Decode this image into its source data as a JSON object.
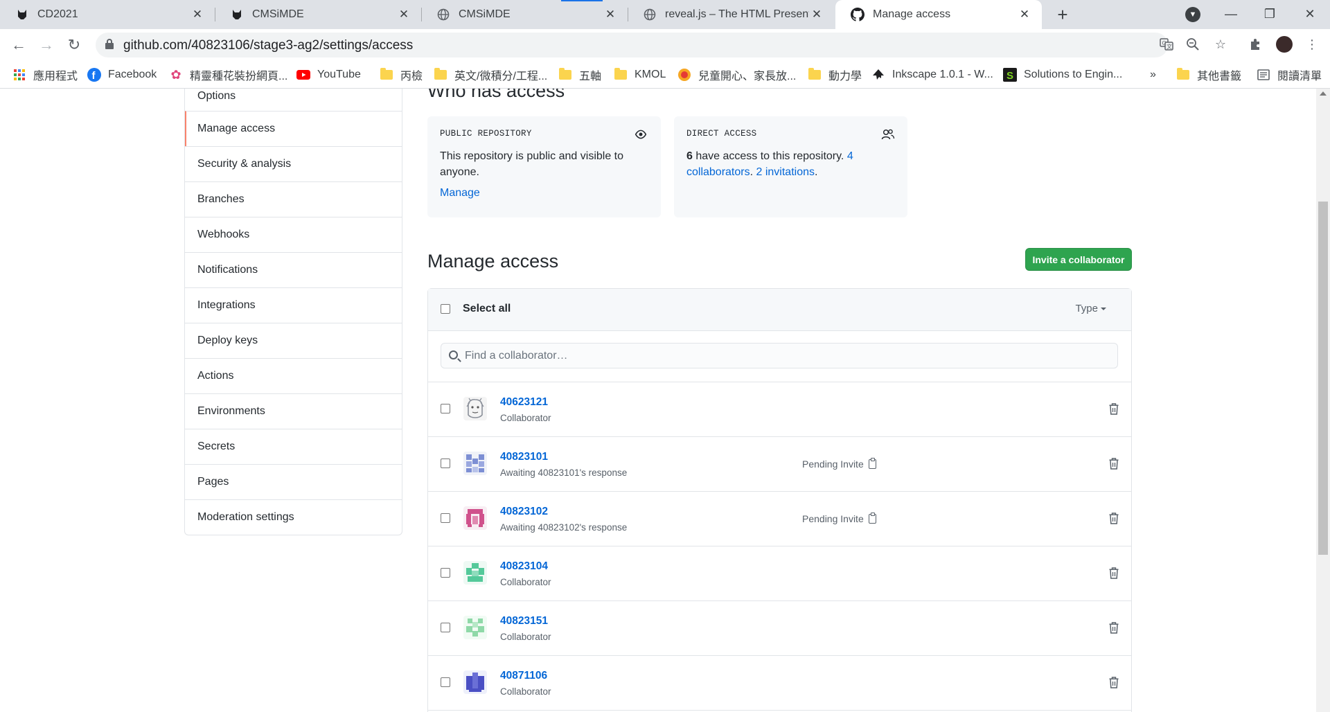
{
  "browser": {
    "tabs": [
      {
        "title": "CD2021",
        "icon": "cmsimde-cat-icon",
        "active": false
      },
      {
        "title": "CMSiMDE",
        "icon": "cmsimde-cat-icon",
        "active": false
      },
      {
        "title": "CMSiMDE",
        "icon": "globe-icon",
        "active": false
      },
      {
        "title": "reveal.js – The HTML Presentati",
        "icon": "globe-icon",
        "active": false
      },
      {
        "title": "Manage access",
        "icon": "github-icon",
        "active": true
      }
    ],
    "url": "github.com/40823106/stage3-ag2/settings/access",
    "bookmarks": [
      {
        "label": "應用程式",
        "icon": "apps-grid-icon"
      },
      {
        "label": "Facebook",
        "icon": "facebook-icon"
      },
      {
        "label": "精靈種花裝扮網頁...",
        "icon": "flower-icon"
      },
      {
        "label": "YouTube",
        "icon": "youtube-icon"
      },
      {
        "label": "丙檢",
        "icon": "folder-icon"
      },
      {
        "label": "英文/微積分/工程...",
        "icon": "folder-icon"
      },
      {
        "label": "五軸",
        "icon": "folder-icon"
      },
      {
        "label": "KMOL",
        "icon": "folder-icon"
      },
      {
        "label": "兒童開心、家長放...",
        "icon": "kids-site-icon"
      },
      {
        "label": "動力學",
        "icon": "folder-icon"
      },
      {
        "label": "Inkscape 1.0.1 - W...",
        "icon": "inkscape-icon"
      },
      {
        "label": "Solutions to Engin...",
        "icon": "s-logo-icon"
      }
    ],
    "bookmarks_overflow": "»",
    "other_bookmarks": "其他書籤",
    "reading_list": "閱讀清單"
  },
  "sidebar": {
    "items": [
      {
        "label": "Options",
        "selected": false
      },
      {
        "label": "Manage access",
        "selected": true
      },
      {
        "label": "Security & analysis",
        "selected": false
      },
      {
        "label": "Branches",
        "selected": false
      },
      {
        "label": "Webhooks",
        "selected": false
      },
      {
        "label": "Notifications",
        "selected": false
      },
      {
        "label": "Integrations",
        "selected": false
      },
      {
        "label": "Deploy keys",
        "selected": false
      },
      {
        "label": "Actions",
        "selected": false
      },
      {
        "label": "Environments",
        "selected": false
      },
      {
        "label": "Secrets",
        "selected": false
      },
      {
        "label": "Pages",
        "selected": false
      },
      {
        "label": "Moderation settings",
        "selected": false
      }
    ]
  },
  "who_has_access": {
    "title": "Who has access",
    "public_repo": {
      "caption": "PUBLIC REPOSITORY",
      "text": "This repository is public and visible to anyone.",
      "link": "Manage"
    },
    "direct_access": {
      "caption": "DIRECT ACCESS",
      "count": "6",
      "text": " have access to this repository. ",
      "collaborators_link": "4 collaborators",
      "sep": ". ",
      "invitations_link": "2 invitations",
      "end": "."
    }
  },
  "manage_access": {
    "title": "Manage access",
    "invite_button": "Invite a collaborator",
    "select_all": "Select all",
    "type_filter": "Type",
    "search_placeholder": "Find a collaborator…",
    "collaborators": [
      {
        "username": "40623121",
        "role": "Collaborator",
        "pending": "",
        "avatar_color": "#8a8f99"
      },
      {
        "username": "40823101",
        "role": "Awaiting 40823101's response",
        "pending": "Pending Invite",
        "avatar_color": "#7d8fd4"
      },
      {
        "username": "40823102",
        "role": "Awaiting 40823102's response",
        "pending": "Pending Invite",
        "avatar_color": "#d0528c"
      },
      {
        "username": "40823104",
        "role": "Collaborator",
        "pending": "",
        "avatar_color": "#54c99a"
      },
      {
        "username": "40823151",
        "role": "Collaborator",
        "pending": "",
        "avatar_color": "#8fd9a8"
      },
      {
        "username": "40871106",
        "role": "Collaborator",
        "pending": "",
        "avatar_color": "#4a4fc4"
      }
    ]
  },
  "colors": {
    "link": "#0366d6",
    "invite_green": "#2ea44f",
    "selected_accent": "#f9826c"
  }
}
